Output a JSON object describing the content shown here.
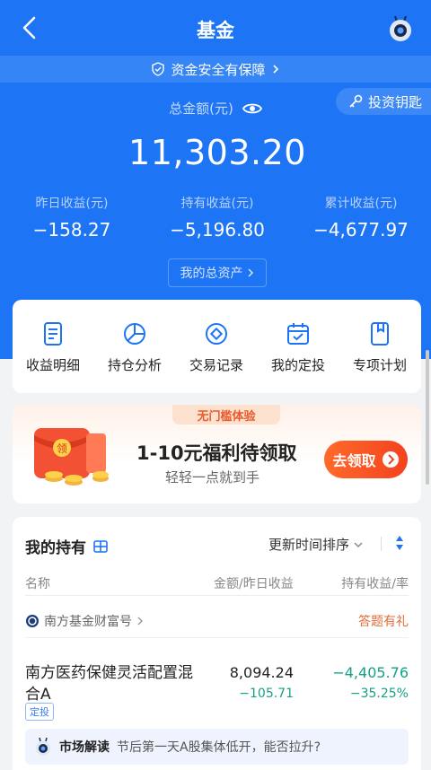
{
  "nav": {
    "title": "基金"
  },
  "safety": {
    "text": "资金安全有保障"
  },
  "invest_key": {
    "label": "投资钥匙"
  },
  "summary": {
    "total_label": "总金额(元)",
    "total_amount": "11,303.20",
    "stats": [
      {
        "label": "昨日收益(元)",
        "value": "−158.27"
      },
      {
        "label": "持有收益(元)",
        "value": "−5,196.80"
      },
      {
        "label": "累计收益(元)",
        "value": "−4,677.97"
      }
    ],
    "assets_button": "我的总资产"
  },
  "quick_actions": [
    {
      "label": "收益明细",
      "icon": "document-icon"
    },
    {
      "label": "持仓分析",
      "icon": "pie-chart-icon"
    },
    {
      "label": "交易记录",
      "icon": "coin-icon"
    },
    {
      "label": "我的定投",
      "icon": "calendar-icon"
    },
    {
      "label": "专项计划",
      "icon": "bookmark-icon"
    }
  ],
  "promo": {
    "tag": "无门槛体验",
    "title": "1-10元福利待领取",
    "subtitle": "轻轻一点就到手",
    "button": "去领取",
    "envelope_char": "领"
  },
  "holdings": {
    "title": "我的持有",
    "sort_label": "更新时间排序",
    "columns": {
      "name": "名称",
      "amount": "金额/昨日收益",
      "profit": "持有收益/率"
    },
    "company": "南方基金财富号",
    "company_action": "答题有礼",
    "fund": {
      "name": "南方医药保健灵活配置混合A",
      "tag": "定投",
      "amount": "8,094.24",
      "yesterday": "−105.71",
      "hold_profit": "−4,405.76",
      "hold_rate": "−35.25%"
    },
    "market": {
      "title": "市场解读",
      "desc": "节后第一天A股集体低开，能否拉升?"
    }
  },
  "colors": {
    "primary": "#1d74f5",
    "loss": "#16a085",
    "promo": "#f4421f"
  }
}
